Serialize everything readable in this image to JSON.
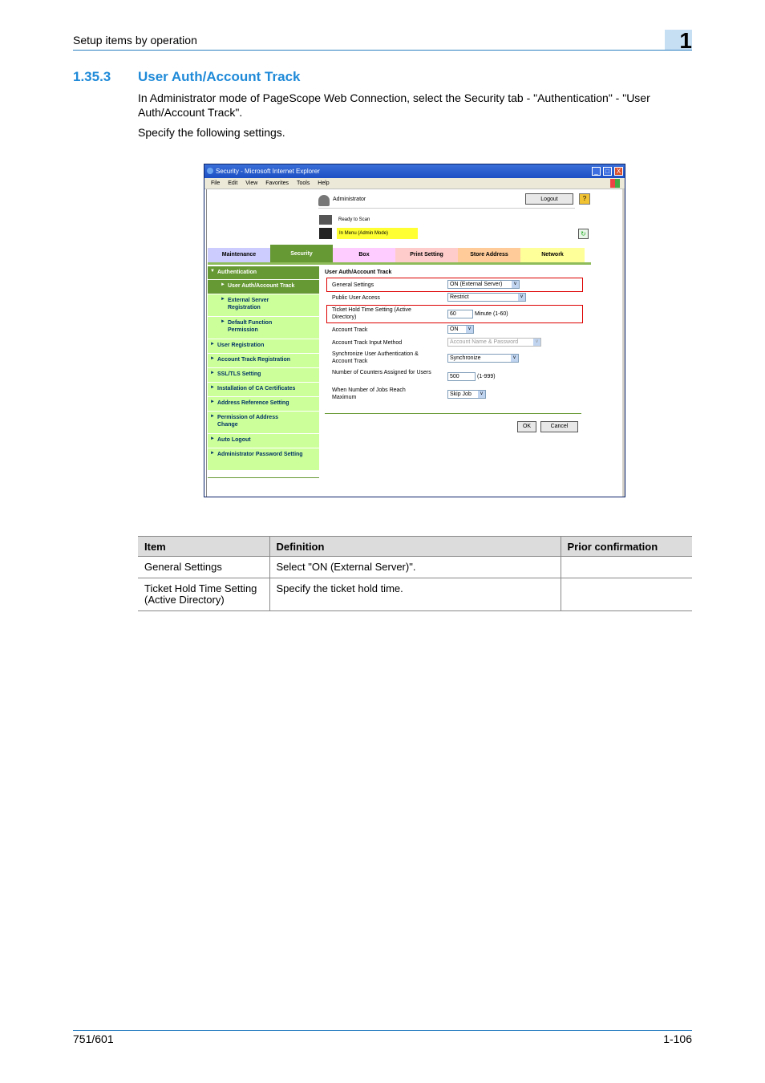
{
  "header": {
    "section_label": "Setup items by operation",
    "chapter": "1"
  },
  "section": {
    "number": "1.35.3",
    "title": "User Auth/Account Track"
  },
  "intro": "In Administrator mode of PageScope Web Connection, select the Security tab - \"Authentication\" - \"User Auth/Account Track\".",
  "instruction": "Specify the following settings.",
  "screenshot": {
    "window_title": "Security - Microsoft Internet Explorer",
    "window_buttons": {
      "minimize": "_",
      "maximize": "□",
      "close": "X"
    },
    "menu": [
      "File",
      "Edit",
      "View",
      "Favorites",
      "Tools",
      "Help"
    ],
    "user_label": "Administrator",
    "logout_label": "Logout",
    "help_label": "?",
    "status_ready": "Ready to Scan",
    "status_mode": "In Menu (Admin Mode)",
    "tabs": [
      {
        "label": "Maintenance",
        "color": "#ccccff"
      },
      {
        "label": "Security",
        "color": "#669933"
      },
      {
        "label": "Box",
        "color": "#ffccff"
      },
      {
        "label": "Print Setting",
        "color": "#ffcccc"
      },
      {
        "label": "Store Address",
        "color": "#ffcc99"
      },
      {
        "label": "Network",
        "color": "#ffff99"
      }
    ],
    "sidebar": [
      {
        "label": "Authentication",
        "arrow": "▼"
      },
      {
        "label": "User Auth/Account Track",
        "arrow": "►"
      },
      {
        "label": "External Server Registration",
        "arrow": "►"
      },
      {
        "label": "Default Function Permission",
        "arrow": "►"
      },
      {
        "label": "User Registration",
        "arrow": "►"
      },
      {
        "label": "Account Track Registration",
        "arrow": "►"
      },
      {
        "label": "SSL/TLS Setting",
        "arrow": "►"
      },
      {
        "label": "Installation of CA Certificates",
        "arrow": "►"
      },
      {
        "label": "Address Reference Setting",
        "arrow": "►"
      },
      {
        "label": "Permission of Address Change",
        "arrow": "►"
      },
      {
        "label": "Auto Logout",
        "arrow": "►"
      },
      {
        "label": "Administrator Password Setting",
        "arrow": "►"
      }
    ],
    "form": {
      "title": "User Auth/Account Track",
      "general_settings": {
        "label": "General Settings",
        "value": "ON (External Server)"
      },
      "public_user_access": {
        "label": "Public User Access",
        "value": "Restrict"
      },
      "ticket_hold_time": {
        "label": "Ticket Hold Time Setting (Active Directory)",
        "value": "60",
        "hint": "Minute (1-60)"
      },
      "account_track": {
        "label": "Account Track",
        "value": "ON"
      },
      "account_track_input_method": {
        "label": "Account Track Input Method",
        "value": "Account Name & Password"
      },
      "synchronize": {
        "label": "Synchronize User Authentication & Account Track",
        "value": "Synchronize"
      },
      "number_of_counters": {
        "label": "Number of Counters Assigned for Users",
        "value": "500",
        "hint": "(1-999)"
      },
      "when_max_jobs": {
        "label": "When Number of Jobs Reach Maximum",
        "value": "Skip Job"
      },
      "dropdown_glyph": "v",
      "ok_label": "OK",
      "cancel_label": "Cancel"
    }
  },
  "table": {
    "headers": [
      "Item",
      "Definition",
      "Prior confirmation"
    ],
    "rows": [
      [
        "General Settings",
        "Select \"ON (External Server)\".",
        ""
      ],
      [
        "Ticket Hold Time Setting (Active Directory)",
        "Specify the ticket hold time.",
        ""
      ]
    ]
  },
  "footer": {
    "model": "751/601",
    "page": "1-106"
  }
}
